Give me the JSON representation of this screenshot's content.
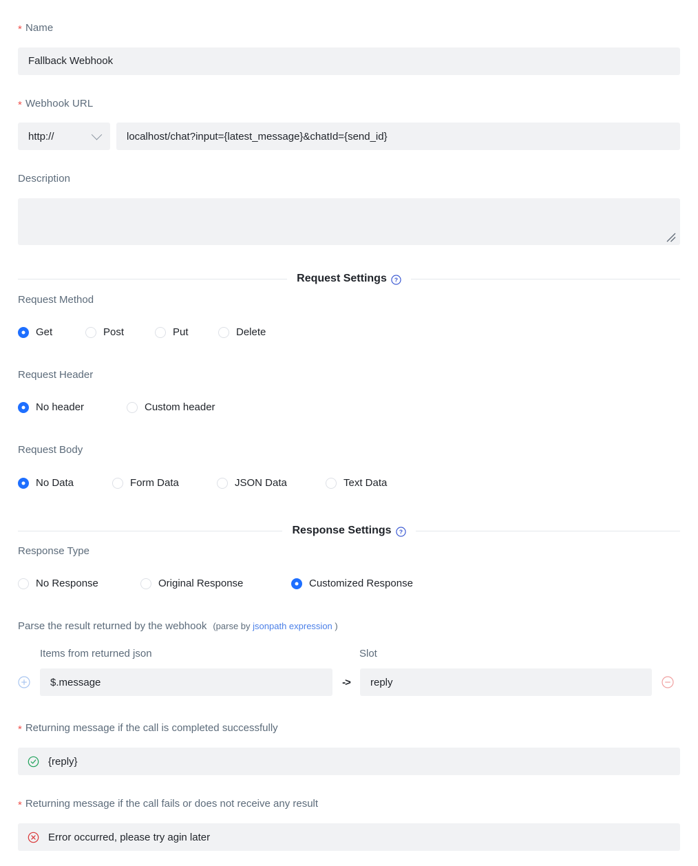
{
  "form": {
    "name": {
      "label": "Name",
      "required": true,
      "value": "Fallback Webhook"
    },
    "webhook_url": {
      "label": "Webhook URL",
      "required": true,
      "protocol": "http://",
      "protocol_icon": "chevron-down-icon",
      "value": "localhost/chat?input={latest_message}&chatId={send_id}"
    },
    "description": {
      "label": "Description",
      "required": false,
      "value": "",
      "placeholder": ""
    }
  },
  "request_settings": {
    "title": "Request Settings",
    "help_icon": "question-circle-icon",
    "request_method": {
      "label": "Request Method",
      "options": [
        "Get",
        "Post",
        "Put",
        "Delete"
      ],
      "selected": "Get"
    },
    "request_header": {
      "label": "Request Header",
      "options": [
        "No header",
        "Custom header"
      ],
      "selected": "No header"
    },
    "request_body": {
      "label": "Request Body",
      "options": [
        "No Data",
        "Form Data",
        "JSON Data",
        "Text Data"
      ],
      "selected": "No Data"
    }
  },
  "response_settings": {
    "title": "Response Settings",
    "help_icon": "question-circle-icon",
    "response_type": {
      "label": "Response Type",
      "options": [
        "No Response",
        "Original Response",
        "Customized Response"
      ],
      "selected": "Customized Response"
    },
    "parse": {
      "text": "Parse the result returned by the webhook",
      "hint_prefix": "(parse by ",
      "hint_link": "jsonpath expression",
      "hint_suffix": " )",
      "col_items": "Items from returned json",
      "col_slot": "Slot",
      "arrow": "->",
      "add_icon": "plus-circle-icon",
      "remove_icon": "minus-circle-icon",
      "mappings": [
        {
          "item": "$.message",
          "slot": "reply"
        }
      ]
    },
    "success": {
      "label": "Returning message if the call is completed successfully",
      "required": true,
      "icon": "check-circle-icon",
      "value": "{reply}"
    },
    "failure": {
      "label": "Returning message if the call fails or does not receive any result",
      "required": true,
      "icon": "error-circle-icon",
      "value": "Error occurred, please try agin later"
    }
  },
  "colors": {
    "accent": "#1e6fff",
    "required": "#f0524d",
    "link": "#4a7fe8",
    "success": "#22a35c",
    "error": "#d93838",
    "input_bg": "#f1f2f4",
    "label": "#5c6b7a"
  }
}
